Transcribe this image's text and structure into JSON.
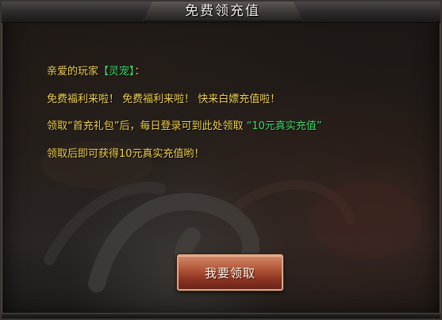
{
  "dialog": {
    "title": "免费领充值",
    "greeting_prefix": "亲爱的玩家",
    "player_name": "【灵宠】",
    "greeting_suffix": "：",
    "line2": "免费福利来啦！  免费福利来啦！  快来白嫖充值啦！",
    "line3_main": "领取“首充礼包”后，每日登录可到此处领取  ",
    "line3_highlight": "“10元真实充值”",
    "line4": "领取后即可获得10元真实充值哟！",
    "claim_button": "我要领取"
  },
  "colors": {
    "text_yellow": "#f2d24a",
    "text_green": "#3ddc6a",
    "button_red": "#b3573a",
    "title_white": "#f4eee6"
  }
}
